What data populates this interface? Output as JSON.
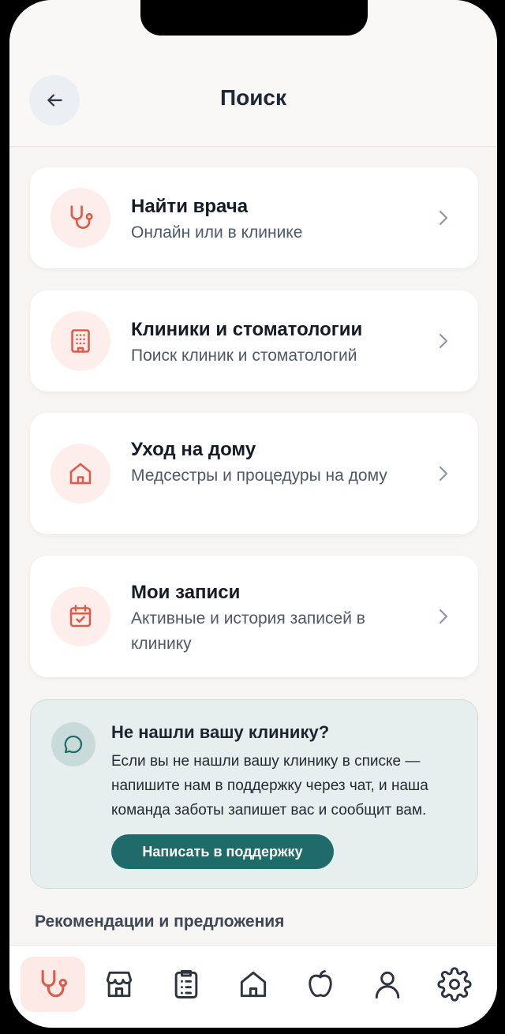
{
  "header": {
    "title": "Поиск"
  },
  "cards": [
    {
      "title": "Найти врача",
      "subtitle": "Онлайн или в клинике",
      "icon": "stethoscope-icon"
    },
    {
      "title": "Клиники и стоматологии",
      "subtitle": "Поиск клиник и стоматологий",
      "icon": "building-icon"
    },
    {
      "title": "Уход на дому",
      "subtitle": "Медсестры и процедуры на дому",
      "icon": "home-icon"
    },
    {
      "title": "Мои записи",
      "subtitle": "Активные и история записей в клинику",
      "icon": "calendar-check-icon"
    }
  ],
  "support": {
    "title": "Не нашли вашу клинику?",
    "text": "Если вы не нашли вашу клинику в списке — напишите нам в поддержку через чат, и наша команда заботы запишет вас и сообщит вам.",
    "button_label": "Написать в поддержку"
  },
  "recommendations": {
    "title": "Рекомендации и предложения"
  },
  "tabbar": {
    "active_index": 0,
    "items": [
      "stethoscope-icon",
      "store-icon",
      "clipboard-icon",
      "home-icon",
      "apple-icon",
      "user-icon",
      "gear-icon"
    ]
  },
  "colors": {
    "accent": "#e05a47",
    "accent_bg": "#fdeeeb",
    "teal": "#1f6b6a"
  }
}
